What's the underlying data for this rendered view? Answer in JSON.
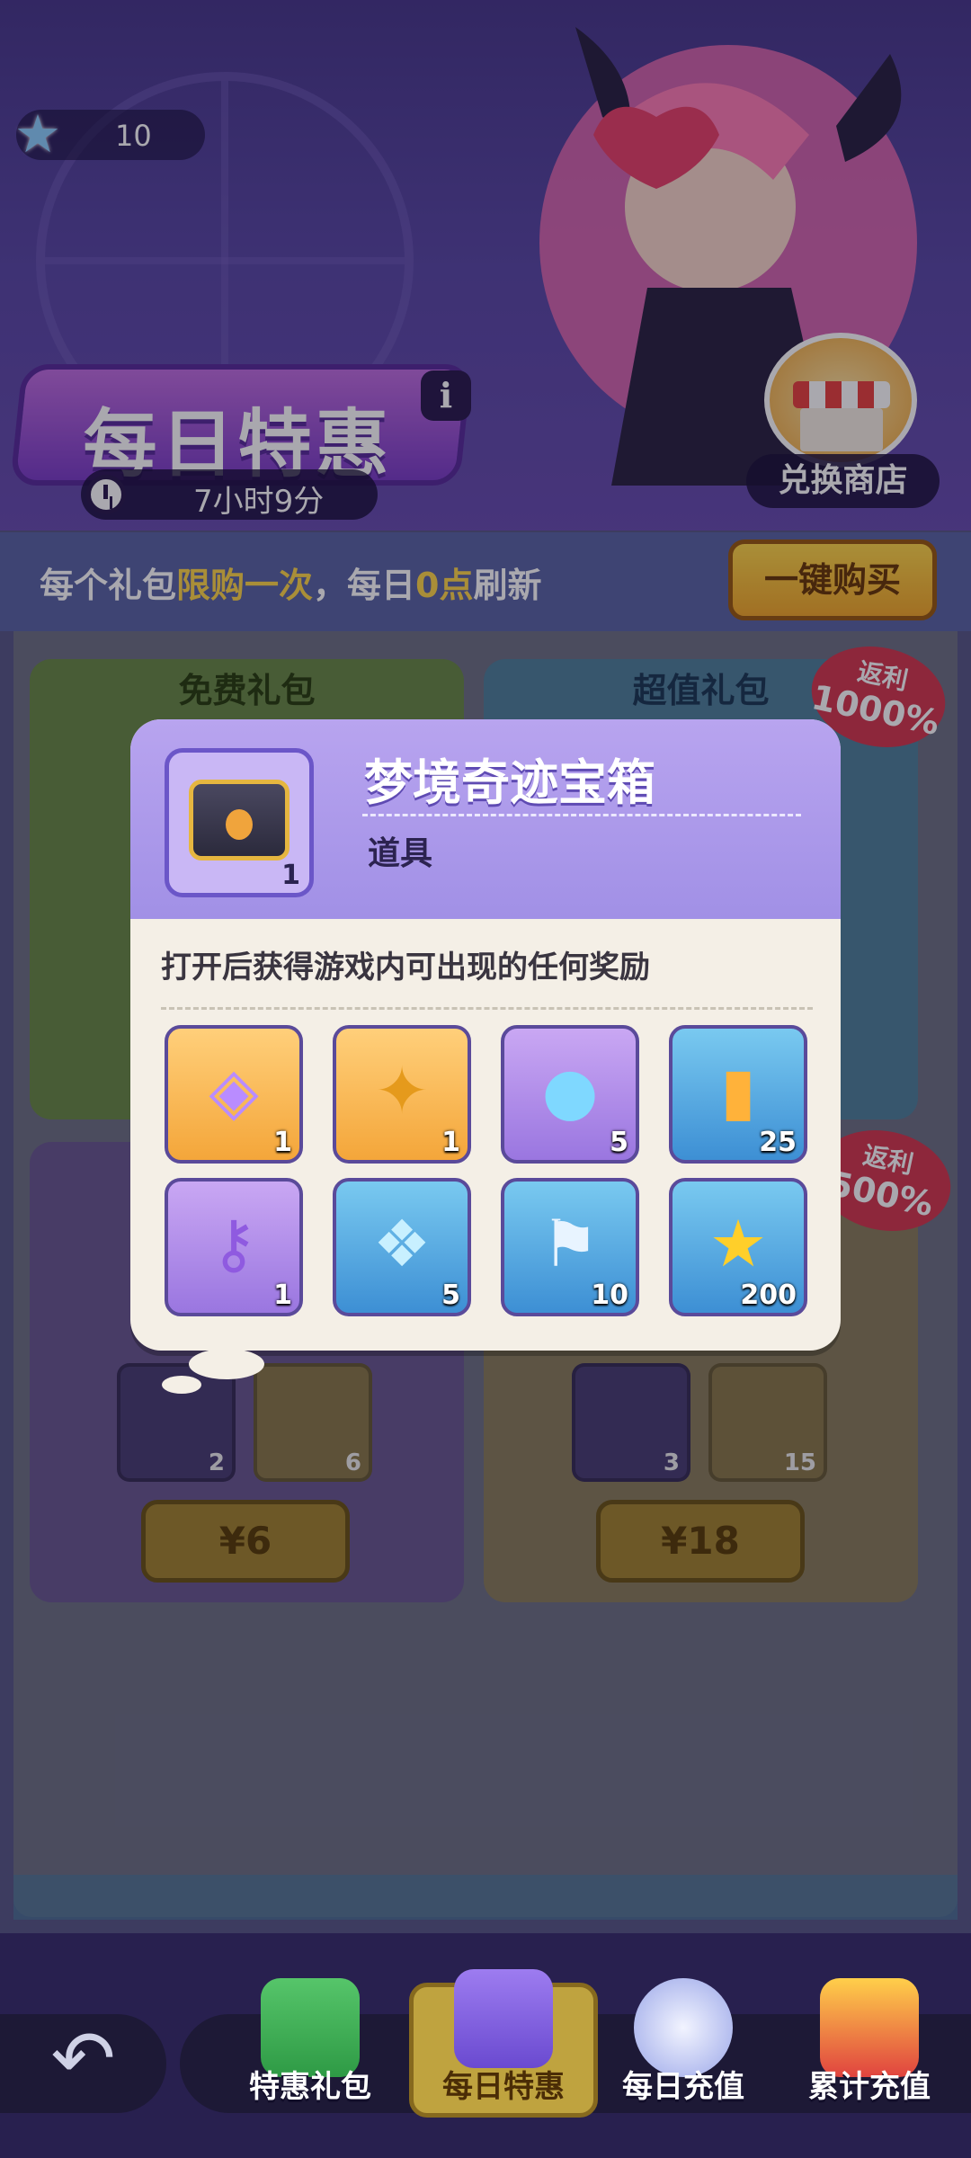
{
  "header": {
    "star_count": "10",
    "title": "每日特惠",
    "timer": "7小时9分",
    "shop_label": "兑换商店"
  },
  "notice": {
    "prefix": "每个礼包",
    "highlight": "限购一次",
    "middle": "，每日",
    "highlight2": "0点",
    "suffix": "刷新",
    "buy_all": "一键购买"
  },
  "cards": {
    "free": {
      "title": "免费礼包"
    },
    "value": {
      "title": "超值礼包",
      "rebate_label": "返利",
      "rebate_value": "1000%"
    },
    "p6": {
      "price": "¥6",
      "items": [
        {
          "count": "2"
        },
        {
          "count": "6"
        }
      ]
    },
    "p18": {
      "rebate_label": "返利",
      "rebate_value": "500%",
      "price": "¥18",
      "items": [
        {
          "count": "3"
        },
        {
          "count": "15"
        }
      ]
    }
  },
  "popup": {
    "item_name": "梦境奇迹宝箱",
    "item_type": "道具",
    "item_count": "1",
    "description": "打开后获得游戏内可出现的任何奖励",
    "rewards": [
      {
        "icon": "rainbow-cube-icon",
        "count": "1",
        "color": "gold"
      },
      {
        "icon": "star-key-icon",
        "count": "1",
        "color": "gold"
      },
      {
        "icon": "blue-flame-icon",
        "count": "5",
        "color": "purple"
      },
      {
        "icon": "mystery-bottle-icon",
        "count": "25",
        "color": "blue"
      },
      {
        "icon": "purple-key-icon",
        "count": "1",
        "color": "purple"
      },
      {
        "icon": "ice-crystal-icon",
        "count": "5",
        "color": "blue"
      },
      {
        "icon": "helmet-flag-icon",
        "count": "10",
        "color": "blue"
      },
      {
        "icon": "gold-coin-icon",
        "count": "200",
        "color": "blue"
      }
    ]
  },
  "nav": {
    "tabs": [
      {
        "label": "特惠礼包"
      },
      {
        "label": "每日特惠"
      },
      {
        "label": "每日充值"
      },
      {
        "label": "累计充值"
      }
    ]
  }
}
